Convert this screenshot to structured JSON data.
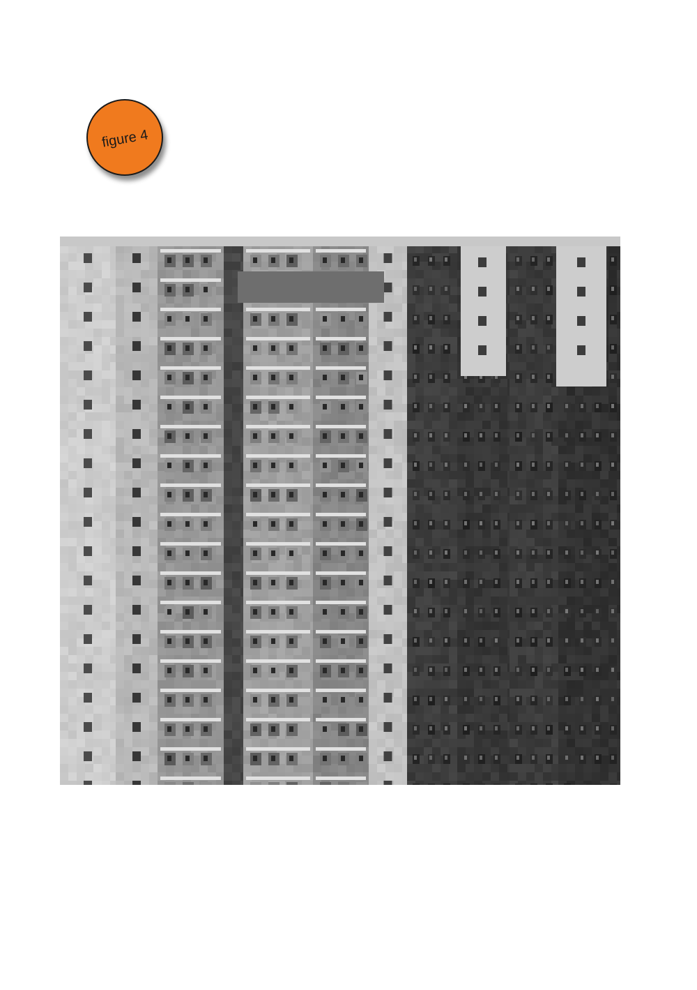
{
  "badge": {
    "label": "figure 4",
    "color": "#f07a1e"
  },
  "photo": {
    "icon": "tower-block-photo-icon",
    "palette": {
      "light_facade": "#c8c8c8",
      "mid_facade": "#8e8e8e",
      "dark_facade": "#3a3a3a",
      "window_dark": "#2b2b2b",
      "window_light": "#d6d6d6"
    }
  }
}
